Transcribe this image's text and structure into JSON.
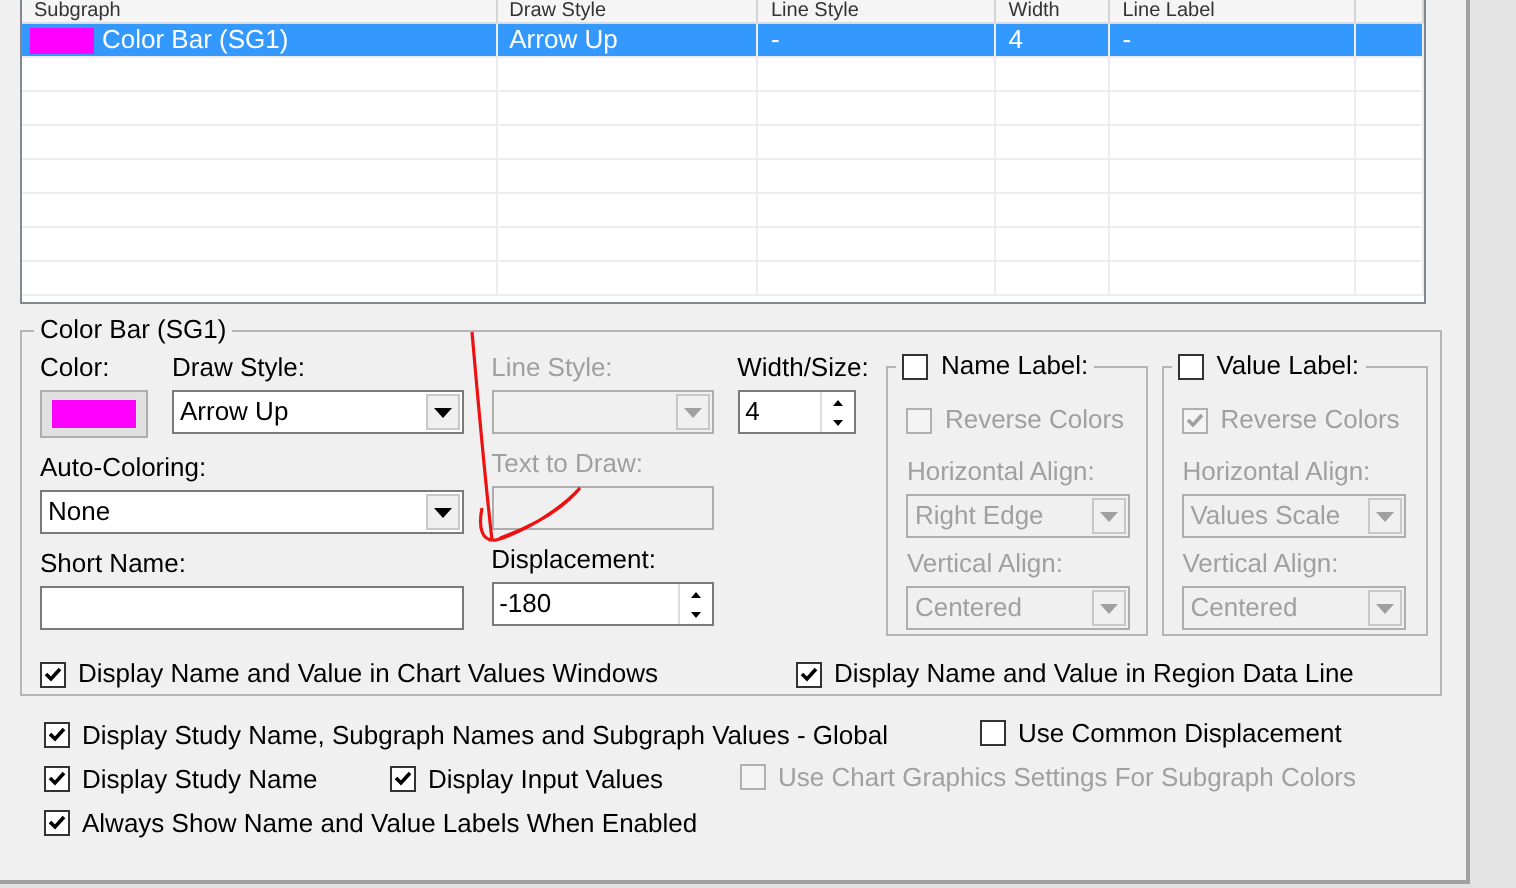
{
  "table": {
    "columns": [
      "Subgraph",
      "Draw Style",
      "Line Style",
      "Width",
      "Line Label"
    ],
    "rows": [
      {
        "color": "#ff00ff",
        "cells": [
          "Color Bar (SG1)",
          "Arrow Up",
          "-",
          "4",
          "-"
        ],
        "selected": true
      }
    ]
  },
  "subgraph_group": {
    "title": "Color Bar (SG1)",
    "color_field": {
      "label": "Color:",
      "color": "#ff00ff"
    },
    "draw_style": {
      "label": "Draw Style:",
      "value": "Arrow Up",
      "disabled": false
    },
    "line_style": {
      "label": "Line Style:",
      "disabled": true
    },
    "width_size": {
      "label": "Width/Size:",
      "value": "4",
      "disabled": false
    },
    "auto_coloring": {
      "label": "Auto-Coloring:",
      "value": "None",
      "disabled": false
    },
    "text_to_draw": {
      "label": "Text to Draw:",
      "disabled": true
    },
    "short_name": {
      "label": "Short Name:",
      "disabled": false
    },
    "displacement": {
      "label": "Displacement:",
      "value": "-180",
      "disabled": false
    },
    "label_groups": [
      {
        "label": "Name Label:",
        "checked": false,
        "reverse_colors": {
          "label": "Reverse Colors",
          "checked": false,
          "disabled": true
        },
        "horizontal_align": {
          "label": "Horizontal Align:",
          "value": "Right Edge",
          "disabled": true
        },
        "vertical_align": {
          "label": "Vertical Align:",
          "value": "Centered",
          "disabled": true
        }
      },
      {
        "label": "Value Label:",
        "checked": false,
        "reverse_colors": {
          "label": "Reverse Colors",
          "checked": true,
          "disabled": true
        },
        "horizontal_align": {
          "label": "Horizontal Align:",
          "value": "Values Scale",
          "disabled": true
        },
        "vertical_align": {
          "label": "Vertical Align:",
          "value": "Centered",
          "disabled": true
        }
      }
    ],
    "options": [
      {
        "label": "Display Name and Value in Chart Values Windows",
        "checked": true
      },
      {
        "label": "Display Name and Value in Region Data Line",
        "checked": true
      }
    ]
  },
  "global_options": [
    [
      {
        "label": "Display Study Name, Subgraph Names and Subgraph Values - Global",
        "checked": true,
        "disabled": false
      },
      {
        "label": "Use Common Displacement",
        "checked": false,
        "disabled": false
      }
    ],
    [
      {
        "label": "Display Study Name",
        "checked": true,
        "disabled": false
      },
      {
        "label": "Display Input Values",
        "checked": true,
        "disabled": false
      },
      {
        "label": "Use Chart Graphics Settings For Subgraph Colors",
        "checked": false,
        "disabled": true
      }
    ],
    [
      {
        "label": "Always Show Name and Value Labels When Enabled",
        "checked": true,
        "disabled": false
      }
    ]
  ]
}
